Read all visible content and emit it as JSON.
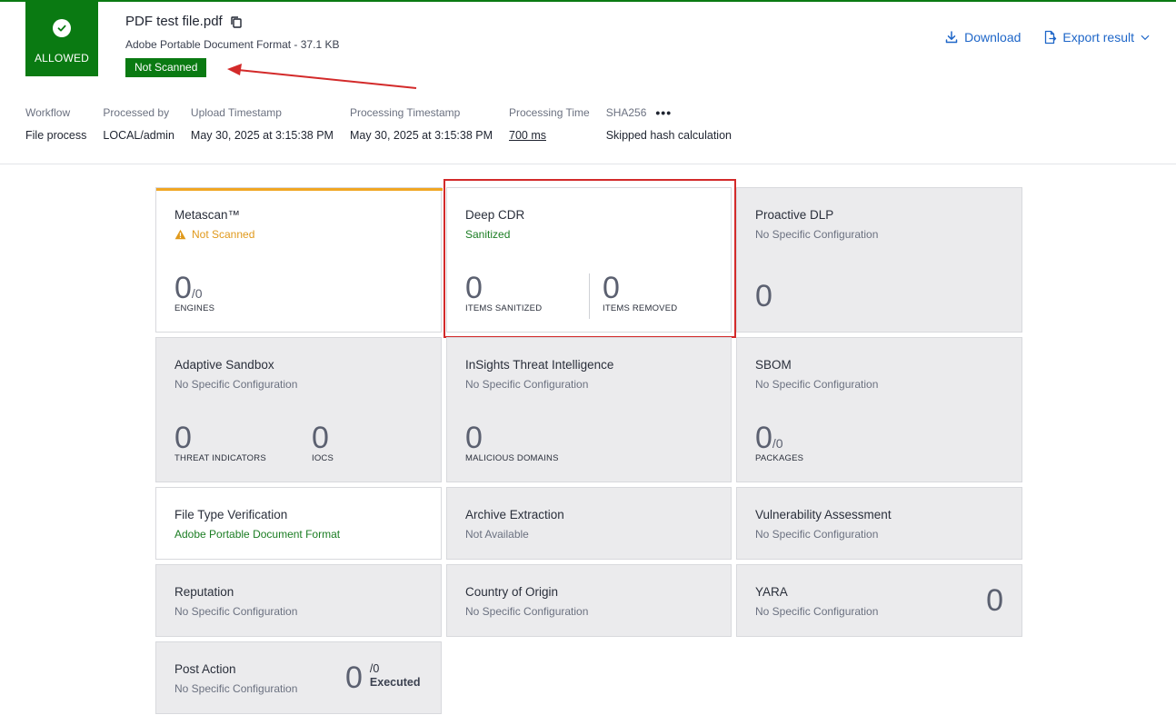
{
  "verdict": {
    "label": "ALLOWED"
  },
  "file": {
    "name": "PDF test file.pdf",
    "type_size": "Adobe Portable Document Format - 37.1 KB",
    "status_badge": "Not Scanned"
  },
  "actions": {
    "download": "Download",
    "export": "Export result"
  },
  "meta": {
    "workflow": {
      "label": "Workflow",
      "value": "File process"
    },
    "processed_by": {
      "label": "Processed by",
      "value": "LOCAL/admin"
    },
    "upload": {
      "label": "Upload Timestamp",
      "value": "May 30, 2025 at 3:15:38 PM"
    },
    "processing_ts": {
      "label": "Processing Timestamp",
      "value": "May 30, 2025 at 3:15:38 PM"
    },
    "processing_time": {
      "label": "Processing Time",
      "value": "700 ms"
    },
    "sha": {
      "label": "SHA256",
      "value": "Skipped hash calculation"
    }
  },
  "tiles": {
    "metascan": {
      "title": "Metascan™",
      "status": "Not Scanned",
      "count": "0",
      "total": "/0",
      "caption": "ENGINES"
    },
    "deepcdr": {
      "title": "Deep CDR",
      "status": "Sanitized",
      "sanitized": "0",
      "sanitized_cap": "ITEMS SANITIZED",
      "removed": "0",
      "removed_cap": "ITEMS REMOVED"
    },
    "dlp": {
      "title": "Proactive DLP",
      "status": "No Specific Configuration",
      "count": "0"
    },
    "sandbox": {
      "title": "Adaptive Sandbox",
      "status": "No Specific Configuration",
      "threats": "0",
      "threats_cap": "THREAT INDICATORS",
      "iocs": "0",
      "iocs_cap": "IOCS"
    },
    "insights": {
      "title": "InSights Threat Intelligence",
      "status": "No Specific Configuration",
      "count": "0",
      "caption": "MALICIOUS DOMAINS"
    },
    "sbom": {
      "title": "SBOM",
      "status": "No Specific Configuration",
      "count": "0",
      "total": "/0",
      "caption": "PACKAGES"
    },
    "ftv": {
      "title": "File Type Verification",
      "status": "Adobe Portable Document Format"
    },
    "archive": {
      "title": "Archive Extraction",
      "status": "Not Available"
    },
    "vuln": {
      "title": "Vulnerability Assessment",
      "status": "No Specific Configuration"
    },
    "reputation": {
      "title": "Reputation",
      "status": "No Specific Configuration"
    },
    "country": {
      "title": "Country of Origin",
      "status": "No Specific Configuration"
    },
    "yara": {
      "title": "YARA",
      "status": "No Specific Configuration",
      "count": "0"
    },
    "postaction": {
      "title": "Post Action",
      "status": "No Specific Configuration",
      "count": "0",
      "total": "/0",
      "executed": "Executed"
    }
  },
  "colors": {
    "allowed_green": "#0a7a12",
    "accent_blue": "#1e66c8",
    "warning_orange": "#e0991b",
    "highlight_red": "#d32a2a"
  }
}
